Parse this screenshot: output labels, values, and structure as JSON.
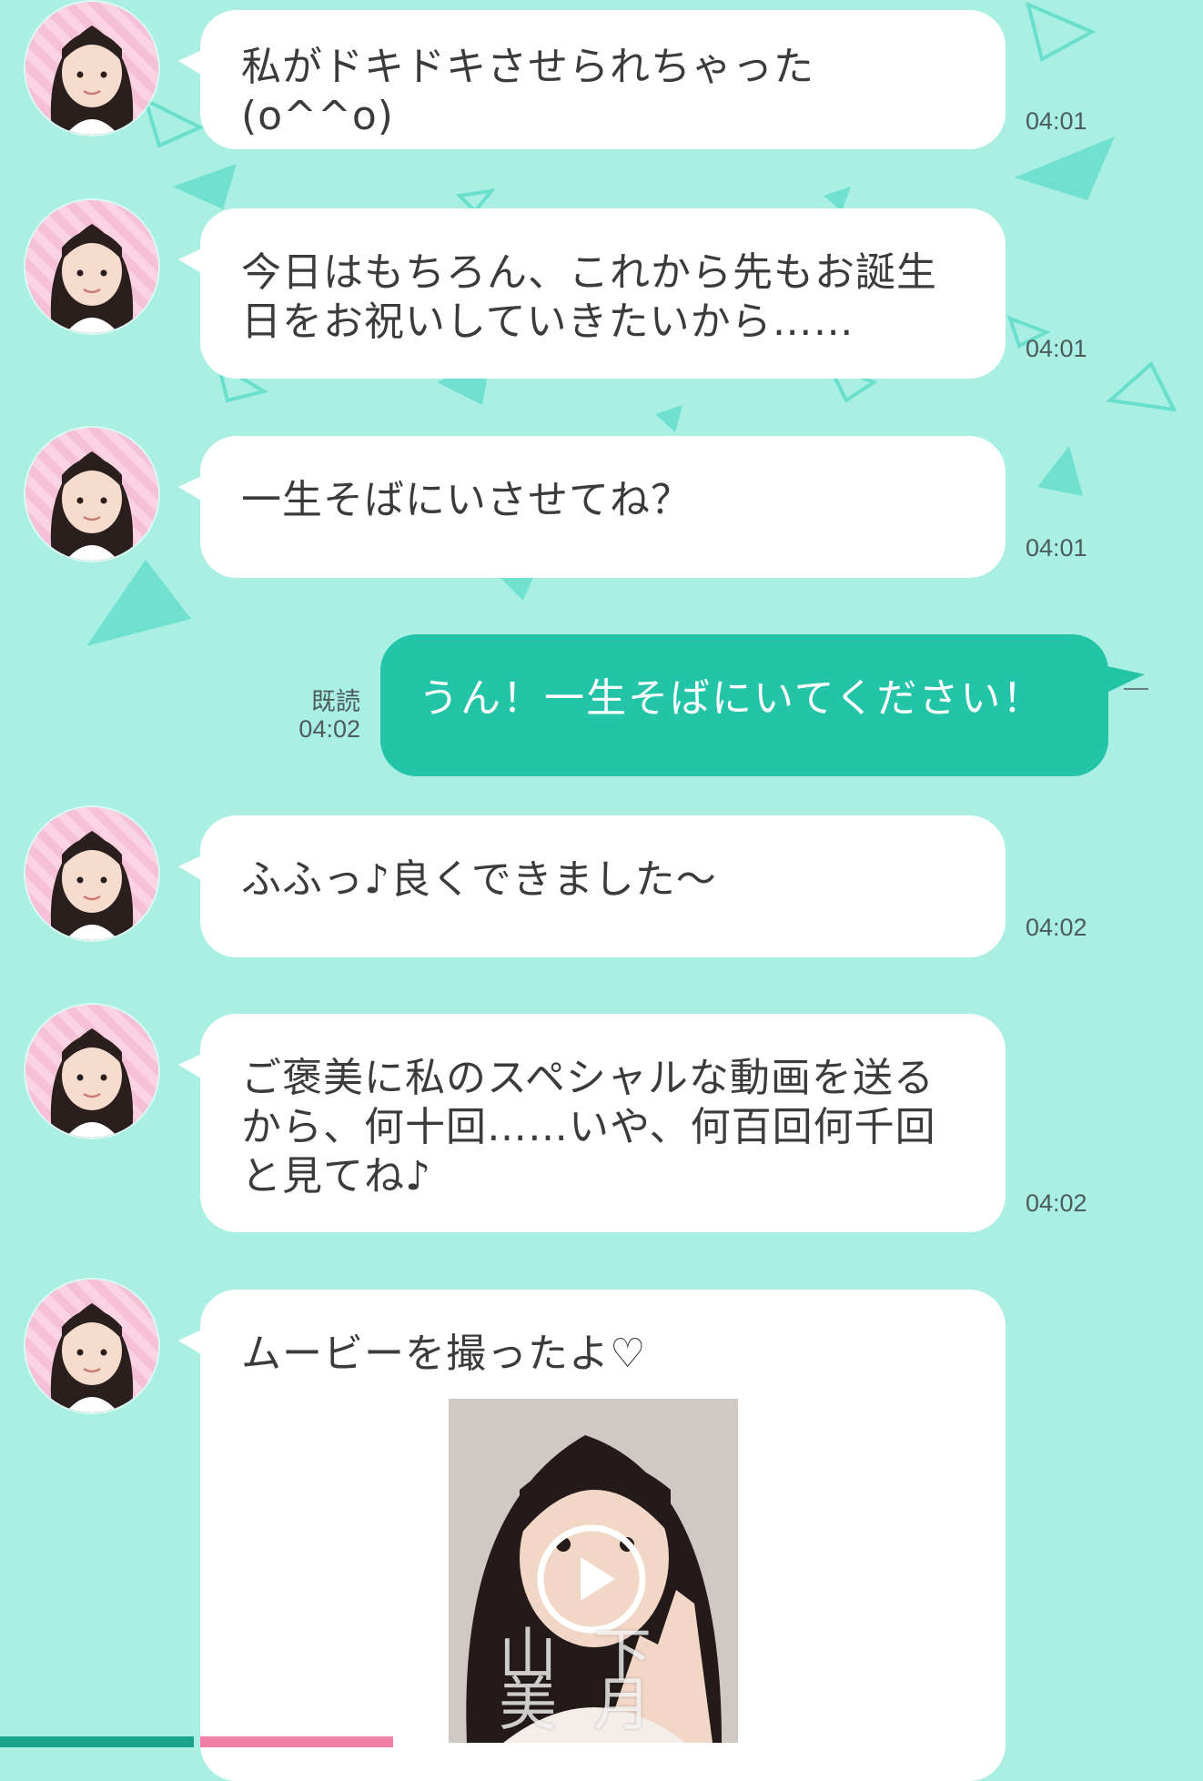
{
  "colors": {
    "background": "#a9efe4",
    "received_bubble": "#ffffff",
    "sent_bubble": "#24c4a8",
    "timestamp_text": "#4d5b59"
  },
  "messages": [
    {
      "type": "received",
      "text": "私がドキドキさせられちゃった(o^^o)",
      "time": "04:01"
    },
    {
      "type": "received",
      "lines": [
        "今日はもちろん、これから先もお誕生",
        "日をお祝いしていきたいから……"
      ],
      "time": "04:01"
    },
    {
      "type": "received",
      "text": "一生そばにいさせてね？",
      "time": "04:01"
    },
    {
      "type": "sent",
      "text": "うん！一生そばにいてください！",
      "read_label": "既読",
      "time": "04:02"
    },
    {
      "type": "received",
      "text": "ふふっ♪良くできました～",
      "time": "04:02"
    },
    {
      "type": "received",
      "lines": [
        "ご褒美に私のスペシャルな動画を送る",
        "から、何十回……いや、何百回何千回",
        "と見てね♪"
      ],
      "time": "04:02"
    },
    {
      "type": "received",
      "text": "ムービーを撮ったよ♡",
      "video": {
        "caption": "山下 美月",
        "icon": "play-icon"
      }
    }
  ]
}
